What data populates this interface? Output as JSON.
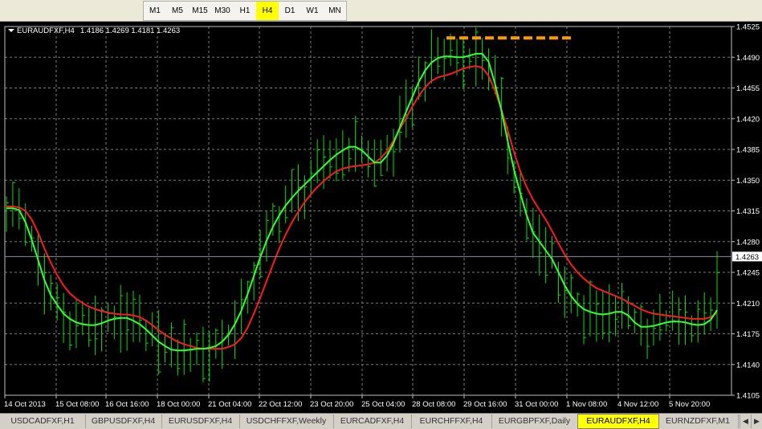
{
  "timeframes": [
    {
      "label": "M1",
      "active": false
    },
    {
      "label": "M5",
      "active": false
    },
    {
      "label": "M15",
      "active": false
    },
    {
      "label": "M30",
      "active": false
    },
    {
      "label": "H1",
      "active": false
    },
    {
      "label": "H4",
      "active": true
    },
    {
      "label": "D1",
      "active": false
    },
    {
      "label": "W1",
      "active": false
    },
    {
      "label": "MN",
      "active": false
    }
  ],
  "chart": {
    "symbol_label": "EURAUDFXF,H4",
    "ohlc": "1.4186 1.4269 1.4181 1.4263",
    "current_price_label": "1.4263"
  },
  "chart_data": {
    "type": "line",
    "y_ticks": [
      "1.4525",
      "1.4490",
      "1.4455",
      "1.4420",
      "1.4385",
      "1.4350",
      "1.4315",
      "1.4280",
      "1.4245",
      "1.4210",
      "1.4175",
      "1.4140",
      "1.4105"
    ],
    "x_ticks": [
      "14 Oct 2013",
      "15 Oct 08:00",
      "16 Oct 16:00",
      "18 Oct 00:00",
      "21 Oct 04:00",
      "22 Oct 12:00",
      "23 Oct 20:00",
      "25 Oct 04:00",
      "28 Oct 08:00",
      "29 Oct 16:00",
      "31 Oct 00:00",
      "1 Nov 08:00",
      "4 Nov 12:00",
      "5 Nov 20:00"
    ],
    "ylim": [
      1.4105,
      1.4525
    ],
    "current_price": 1.4263,
    "resistance_level": 1.4512,
    "colors": {
      "bars": "#00e000",
      "fast_ma": "#33ff33",
      "slow_ma": "#ff1a1a",
      "resistance": "#ff9900",
      "grid": "#6f7f6f",
      "current_line": "#8a8fa0"
    },
    "fast_ma": [
      1.4318,
      1.4318,
      1.4316,
      1.4302,
      1.4282,
      1.4259,
      1.4236,
      1.4219,
      1.4208,
      1.4198,
      1.4192,
      1.4188,
      1.4186,
      1.4185,
      1.4185,
      1.4187,
      1.419,
      1.4192,
      1.4193,
      1.4193,
      1.419,
      1.4186,
      1.418,
      1.4173,
      1.4166,
      1.4161,
      1.4157,
      1.4156,
      1.4156,
      1.4157,
      1.4158,
      1.4158,
      1.4159,
      1.4161,
      1.4166,
      1.4174,
      1.4186,
      1.4201,
      1.422,
      1.4241,
      1.4262,
      1.4281,
      1.4297,
      1.431,
      1.4321,
      1.433,
      1.4338,
      1.4345,
      1.4352,
      1.4359,
      1.4366,
      1.4373,
      1.4379,
      1.4384,
      1.4388,
      1.4388,
      1.4384,
      1.4377,
      1.437,
      1.437,
      1.4378,
      1.4392,
      1.441,
      1.4428,
      1.4445,
      1.4462,
      1.4475,
      1.4484,
      1.4489,
      1.4491,
      1.4491,
      1.449,
      1.449,
      1.4492,
      1.4494,
      1.4494,
      1.4485,
      1.446,
      1.443,
      1.4395,
      1.4362,
      1.4335,
      1.431,
      1.429,
      1.428,
      1.427,
      1.426,
      1.4245,
      1.423,
      1.4218,
      1.4209,
      1.4203,
      1.42,
      1.4198,
      1.4197,
      1.4198,
      1.42,
      1.42,
      1.4196,
      1.4188,
      1.4183,
      1.4183,
      1.4184,
      1.4186,
      1.4188,
      1.4189,
      1.4189,
      1.4188,
      1.4186,
      1.4185,
      1.4186,
      1.4191,
      1.4202
    ],
    "slow_ma": [
      1.432,
      1.432,
      1.4319,
      1.4315,
      1.4305,
      1.429,
      1.4272,
      1.4256,
      1.4242,
      1.423,
      1.4221,
      1.4215,
      1.421,
      1.4206,
      1.4203,
      1.4201,
      1.4199,
      1.4198,
      1.4197,
      1.4197,
      1.4196,
      1.4194,
      1.419,
      1.4185,
      1.4179,
      1.4174,
      1.417,
      1.4166,
      1.4163,
      1.4161,
      1.4159,
      1.4158,
      1.4158,
      1.4158,
      1.4158,
      1.416,
      1.4163,
      1.417,
      1.4182,
      1.4198,
      1.4216,
      1.4235,
      1.4254,
      1.4272,
      1.4288,
      1.4302,
      1.4314,
      1.4325,
      1.4334,
      1.4342,
      1.4349,
      1.4355,
      1.436,
      1.4363,
      1.4365,
      1.4366,
      1.4367,
      1.4368,
      1.437,
      1.4375,
      1.4383,
      1.4395,
      1.4408,
      1.4421,
      1.4434,
      1.4446,
      1.4456,
      1.4463,
      1.4467,
      1.4469,
      1.4471,
      1.4474,
      1.4477,
      1.4479,
      1.448,
      1.4478,
      1.4469,
      1.4452,
      1.4431,
      1.4407,
      1.4382,
      1.436,
      1.4342,
      1.4328,
      1.4316,
      1.4305,
      1.4292,
      1.4278,
      1.4265,
      1.4254,
      1.4245,
      1.4238,
      1.4232,
      1.4227,
      1.4224,
      1.4221,
      1.4218,
      1.4215,
      1.4211,
      1.4207,
      1.4203,
      1.42,
      1.4198,
      1.4197,
      1.4196,
      1.4195,
      1.4194,
      1.4193,
      1.4192,
      1.4192,
      1.4192,
      1.4194,
      1.4199
    ]
  },
  "tabs": [
    {
      "label": "USDCADFXF,H1",
      "active": false
    },
    {
      "label": "GBPUSDFXF,H4",
      "active": false
    },
    {
      "label": "EURUSDFXF,H4",
      "active": false
    },
    {
      "label": "USDCHFFXF,Weekly",
      "active": false
    },
    {
      "label": "EURCADFXF,H4",
      "active": false
    },
    {
      "label": "EURCHFFXF,H4",
      "active": false
    },
    {
      "label": "EURGBPFXF,Daily",
      "active": false
    },
    {
      "label": "EURAUDFXF,H4",
      "active": true
    },
    {
      "label": "EURNZDFXF,M1",
      "active": false
    }
  ],
  "tab_arrows": {
    "left": "◀",
    "right": "▶"
  }
}
